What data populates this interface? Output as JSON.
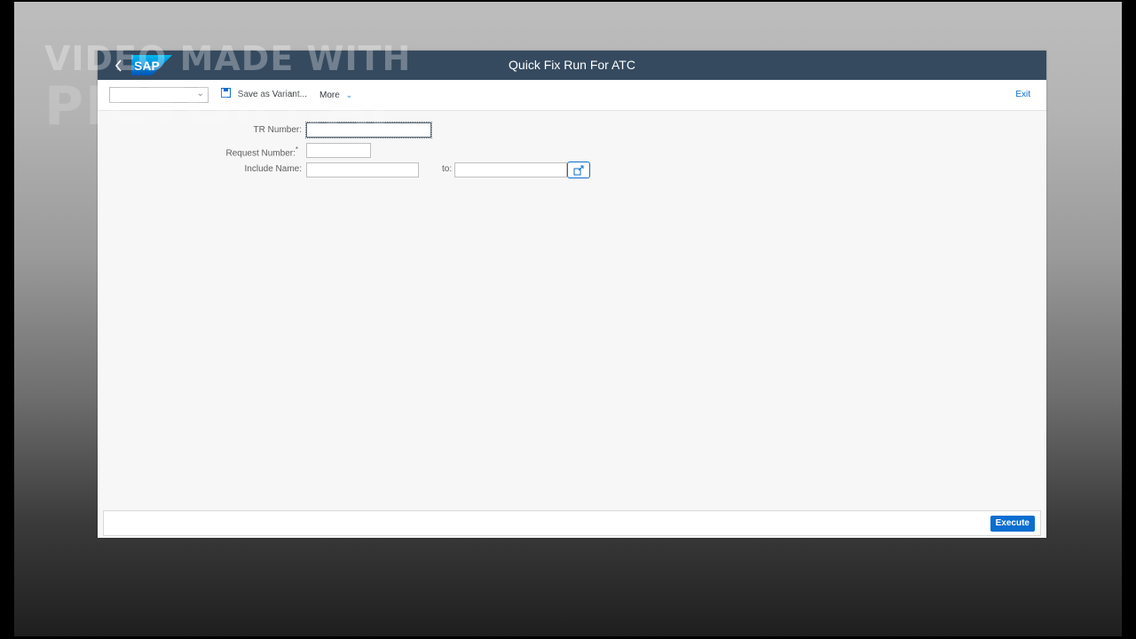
{
  "watermark": {
    "line1": "VIDEO MADE WITH",
    "line2": "PICTORY.AI"
  },
  "shell": {
    "logo_text": "SAP",
    "title": "Quick Fix Run For ATC",
    "back_icon": "chevron-left-icon"
  },
  "toolbar": {
    "variant_value": "",
    "save_variant_label": "Save as Variant...",
    "more_label": "More",
    "exit_label": "Exit"
  },
  "form": {
    "tr_number_label": "TR Number:",
    "tr_number_value": "",
    "request_number_label": "Request Number:",
    "request_number_required": "*",
    "request_number_value": "",
    "include_name_label": "Include Name:",
    "include_name_value": "",
    "to_label": "to:",
    "include_name_to_value": "",
    "multi_select_icon": "multiple-selection-icon"
  },
  "footer": {
    "execute_label": "Execute"
  },
  "colors": {
    "shell_bar": "#354a5f",
    "accent": "#0a6ed1",
    "canvas": "#f7f7f7"
  }
}
